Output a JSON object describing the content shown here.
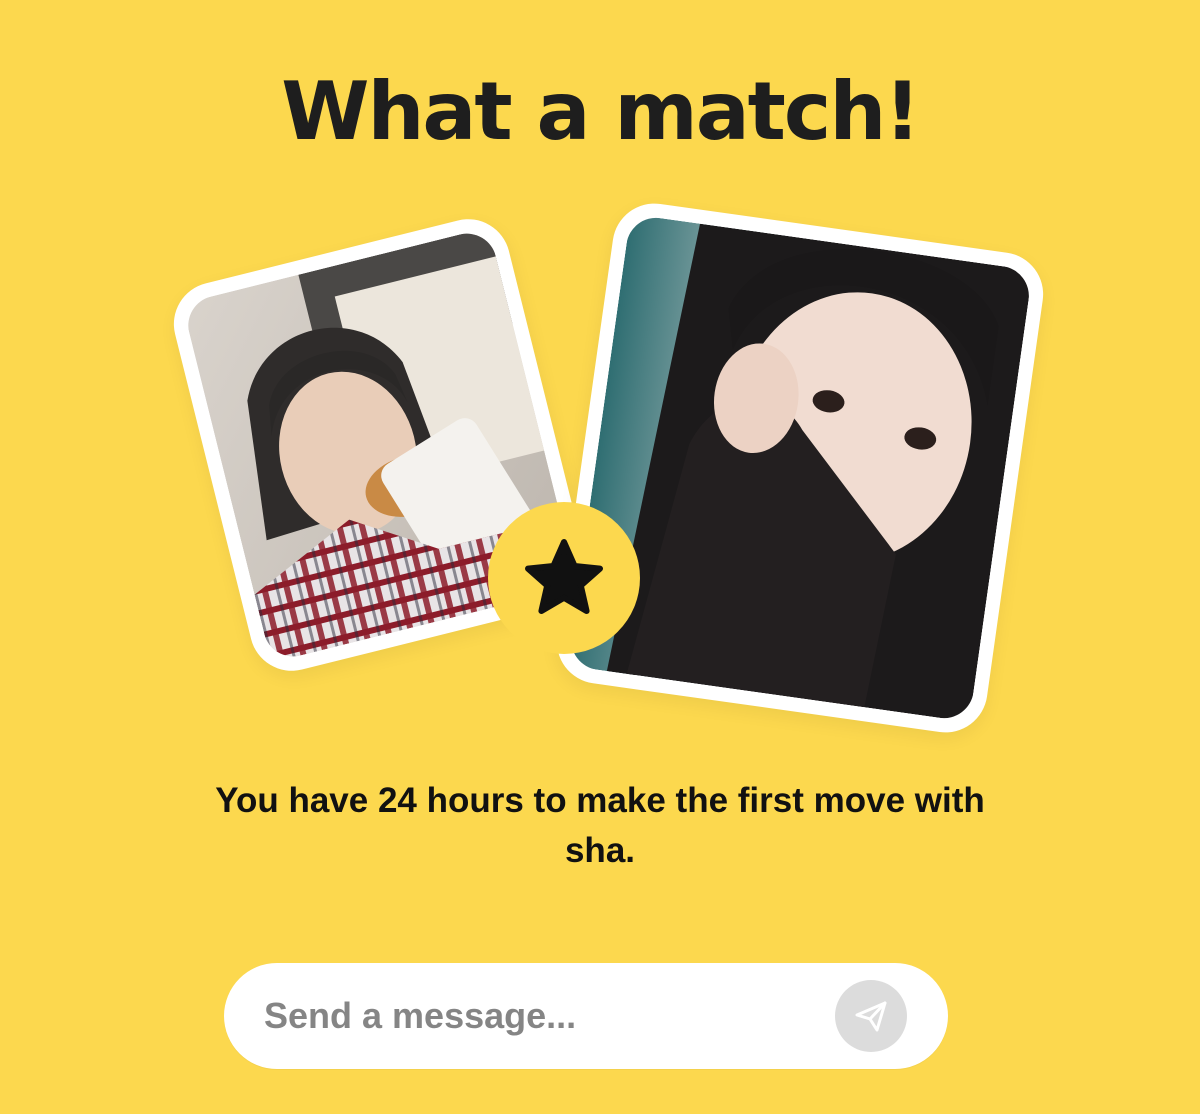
{
  "header": {
    "title": "What a match!"
  },
  "match": {
    "badge_icon": "star-icon",
    "subtitle": "You have 24 hours to make the first move with sha.",
    "photos": [
      {
        "name": "user-photo",
        "description": "profile photo"
      },
      {
        "name": "match-photo",
        "description": "profile photo"
      }
    ]
  },
  "composer": {
    "placeholder": "Send a message...",
    "send_icon": "paper-plane-icon"
  },
  "colors": {
    "background": "#FCD84E",
    "title": "#1E1E1E",
    "card": "#FFFFFF",
    "send_button": "#DCDCDC",
    "placeholder": "#858585"
  }
}
